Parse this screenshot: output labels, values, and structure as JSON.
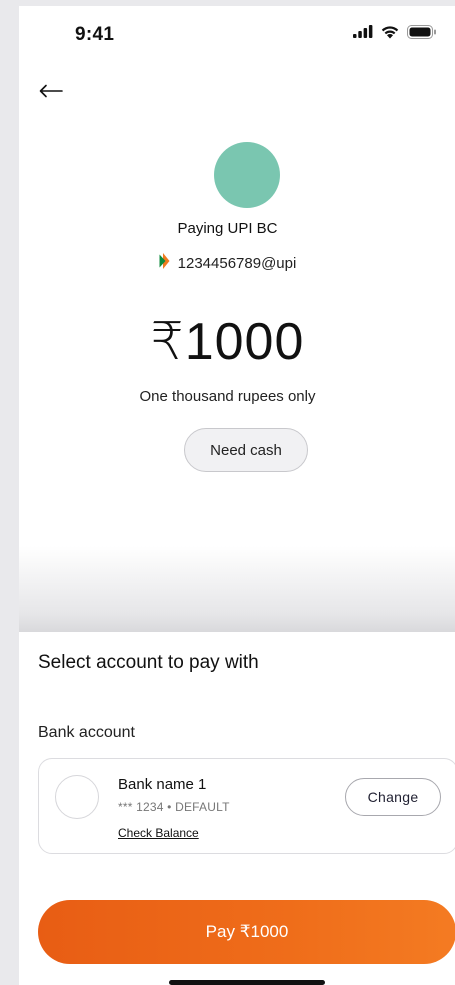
{
  "status_bar": {
    "time": "9:41",
    "icons": [
      "signal-icon",
      "wifi-icon",
      "battery-icon"
    ]
  },
  "header": {
    "back_icon": "arrow-left-icon"
  },
  "payee": {
    "avatar_color": "#7ac6b0",
    "name": "Paying UPI BC",
    "upi_logo_icon": "upi-logo-icon",
    "upi_id": "1234456789@upi"
  },
  "amount": {
    "currency_symbol": "₹",
    "value": "1000",
    "in_words": "One thousand rupees only"
  },
  "need_cash": {
    "label": "Need cash"
  },
  "sheet": {
    "title": "Select account to pay with",
    "section_label": "Bank account",
    "account": {
      "bank_name": "Bank name 1",
      "masked_number": "*** 1234 • DEFAULT",
      "check_balance_label": "Check Balance",
      "change_label": "Change"
    },
    "pay_button_label": "Pay ₹1000"
  },
  "colors": {
    "accent": "#ee6a1a",
    "avatar": "#7ac6b0"
  }
}
